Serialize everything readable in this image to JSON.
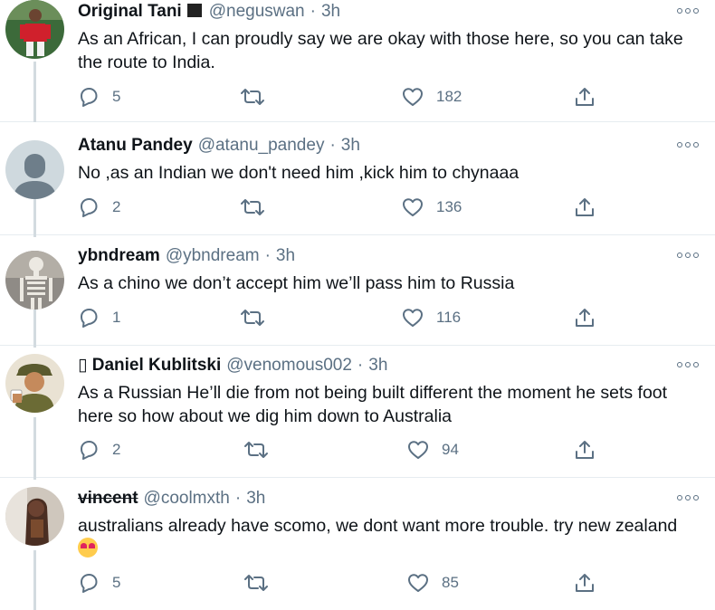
{
  "colors": {
    "text": "#0f1419",
    "secondary": "#5b7083",
    "thread_line": "#d3dbe0",
    "divider": "#e6ecf0"
  },
  "tweets": [
    {
      "name": "Original Tani",
      "handle": "@neguswan",
      "dot": "·",
      "time": "3h",
      "text": "As an African, I can proudly say we are okay with those here, so you can take the route to India.",
      "replies": "5",
      "likes": "182"
    },
    {
      "name": "Atanu Pandey",
      "handle": "@atanu_pandey",
      "dot": "·",
      "time": "3h",
      "text": "No ,as an Indian we don't need him ,kick him to chynaaa",
      "replies": "2",
      "likes": "136"
    },
    {
      "name": "ybndream",
      "handle": "@ybndream",
      "dot": "·",
      "time": "3h",
      "text": "As a chino we don’t accept him we’ll pass him to Russia",
      "replies": "1",
      "likes": "116"
    },
    {
      "name": "▯ Daniel Kublitski",
      "handle": "@venomous002",
      "dot": "·",
      "time": "3h",
      "text": "As a Russian He’ll die from not being built different the moment he sets foot here so how about we dig him down to Australia",
      "replies": "2",
      "likes": "94"
    },
    {
      "name": "vincent",
      "handle": "@coolmxth",
      "dot": "·",
      "time": "3h",
      "text": "australians already have scomo, we dont want more trouble. try new zealand",
      "replies": "5",
      "likes": "85"
    }
  ]
}
